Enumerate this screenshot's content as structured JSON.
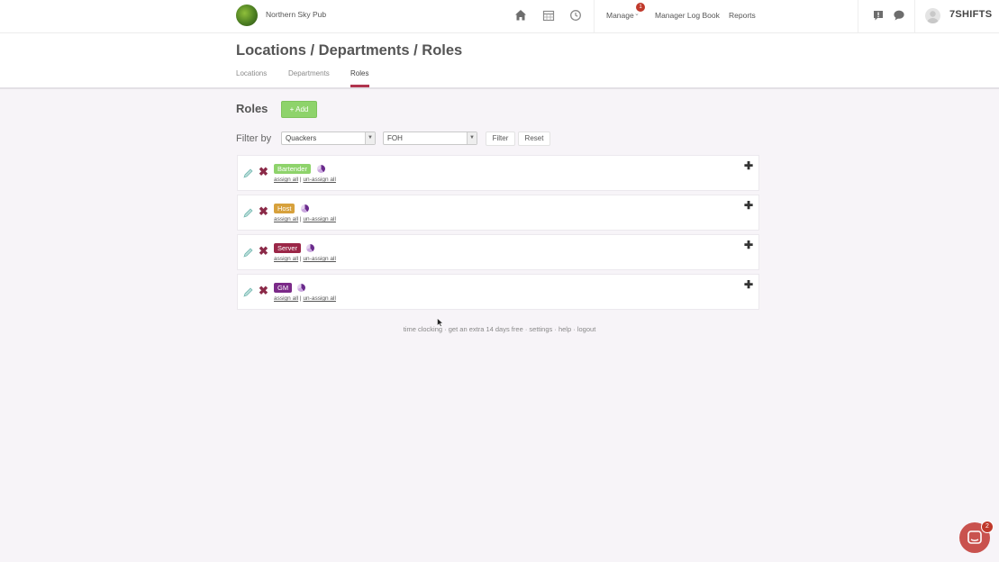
{
  "header": {
    "company_name": "Northern Sky Pub",
    "nav": {
      "manage_label": "Manage",
      "manage_badge": "1",
      "logbook_label": "Manager Log Book",
      "reports_label": "Reports"
    },
    "brand": "7SHIFTS"
  },
  "page": {
    "title": "Locations / Departments / Roles",
    "tabs": [
      {
        "label": "Locations"
      },
      {
        "label": "Departments"
      },
      {
        "label": "Roles",
        "active": true
      }
    ]
  },
  "roles_section": {
    "title": "Roles",
    "add_label": "+ Add"
  },
  "filter": {
    "label": "Filter by",
    "location_value": "Quackers",
    "department_value": "FOH",
    "filter_label": "Filter",
    "reset_label": "Reset"
  },
  "roles": [
    {
      "name": "Bartender",
      "color": "#8ed36b"
    },
    {
      "name": "Host",
      "color": "#d7a13c"
    },
    {
      "name": "Server",
      "color": "#9b2748"
    },
    {
      "name": "GM",
      "color": "#7b2a88"
    }
  ],
  "role_links": {
    "assign_all": "assign all",
    "separator": "|",
    "unassign_all": "un-assign all"
  },
  "footer": {
    "time_clocking": "time clocking",
    "trial": "get an extra 14 days free",
    "settings": "settings",
    "help": "help",
    "logout": "logout",
    "sep": "·"
  },
  "chat_widget": {
    "badge": "2"
  },
  "colors": {
    "accent": "#b0344e",
    "add_green": "#8ed36b",
    "delete": "#8b2a48"
  }
}
